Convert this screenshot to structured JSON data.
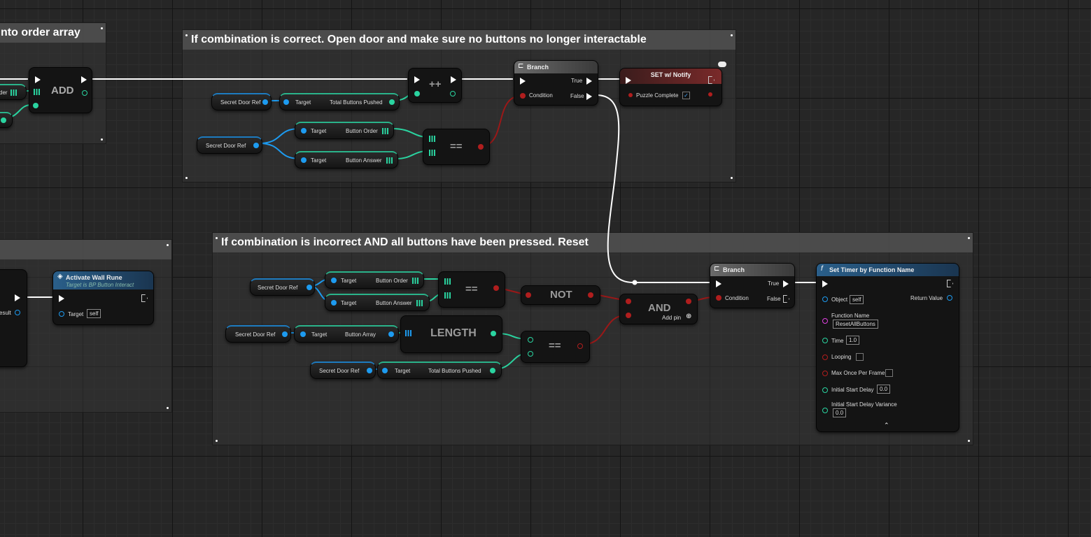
{
  "comments": {
    "order_array": "nto order array",
    "correct": "If combination is correct. Open door and make sure no buttons no longer interactable",
    "incorrect": "If combination is incorrect AND all buttons have been pressed. Reset"
  },
  "nodes": {
    "add": "ADD",
    "increment": "++",
    "secret_door_ref": "Secret Door Ref",
    "target": "Target",
    "total_buttons_pushed": "Total Buttons Pushed",
    "button_order": "Button Order",
    "button_answer": "Button Answer",
    "button_array": "Button Array",
    "equals": "==",
    "branch": "Branch",
    "true_label": "True",
    "false_label": "False",
    "condition": "Condition",
    "set_notify": "SET w/ Notify",
    "puzzle_complete": "Puzzle Complete",
    "not": "NOT",
    "and": "AND",
    "add_pin": "Add pin",
    "length": "LENGTH",
    "activate_wall_rune": "Activate Wall Rune",
    "activate_wall_rune_sub": "Target is BP Button Interact",
    "self": "self",
    "esult": "esult",
    "der": "der",
    "set_timer": "Set Timer by Function Name",
    "object": "Object",
    "return_value": "Return Value",
    "function_name": "Function Name",
    "function_value": "ResetAllButtons",
    "time": "Time",
    "time_value": "1.0",
    "looping": "Looping",
    "max_once": "Max Once Per Frame",
    "initial_start_delay": "Initial Start Delay",
    "initial_start_delay_value": "0.0",
    "initial_start_delay_variance": "Initial Start Delay Variance",
    "initial_start_delay_variance_value": "0.0"
  },
  "colors": {
    "exec": "#ffffff",
    "object_ref": "#1d9bf0",
    "integer": "#2ad4a0",
    "boolean": "#b01e1e",
    "branch_header": "#5a5a5a",
    "set_header": "#7a2a2a",
    "function_header": "#2a5f8a"
  }
}
